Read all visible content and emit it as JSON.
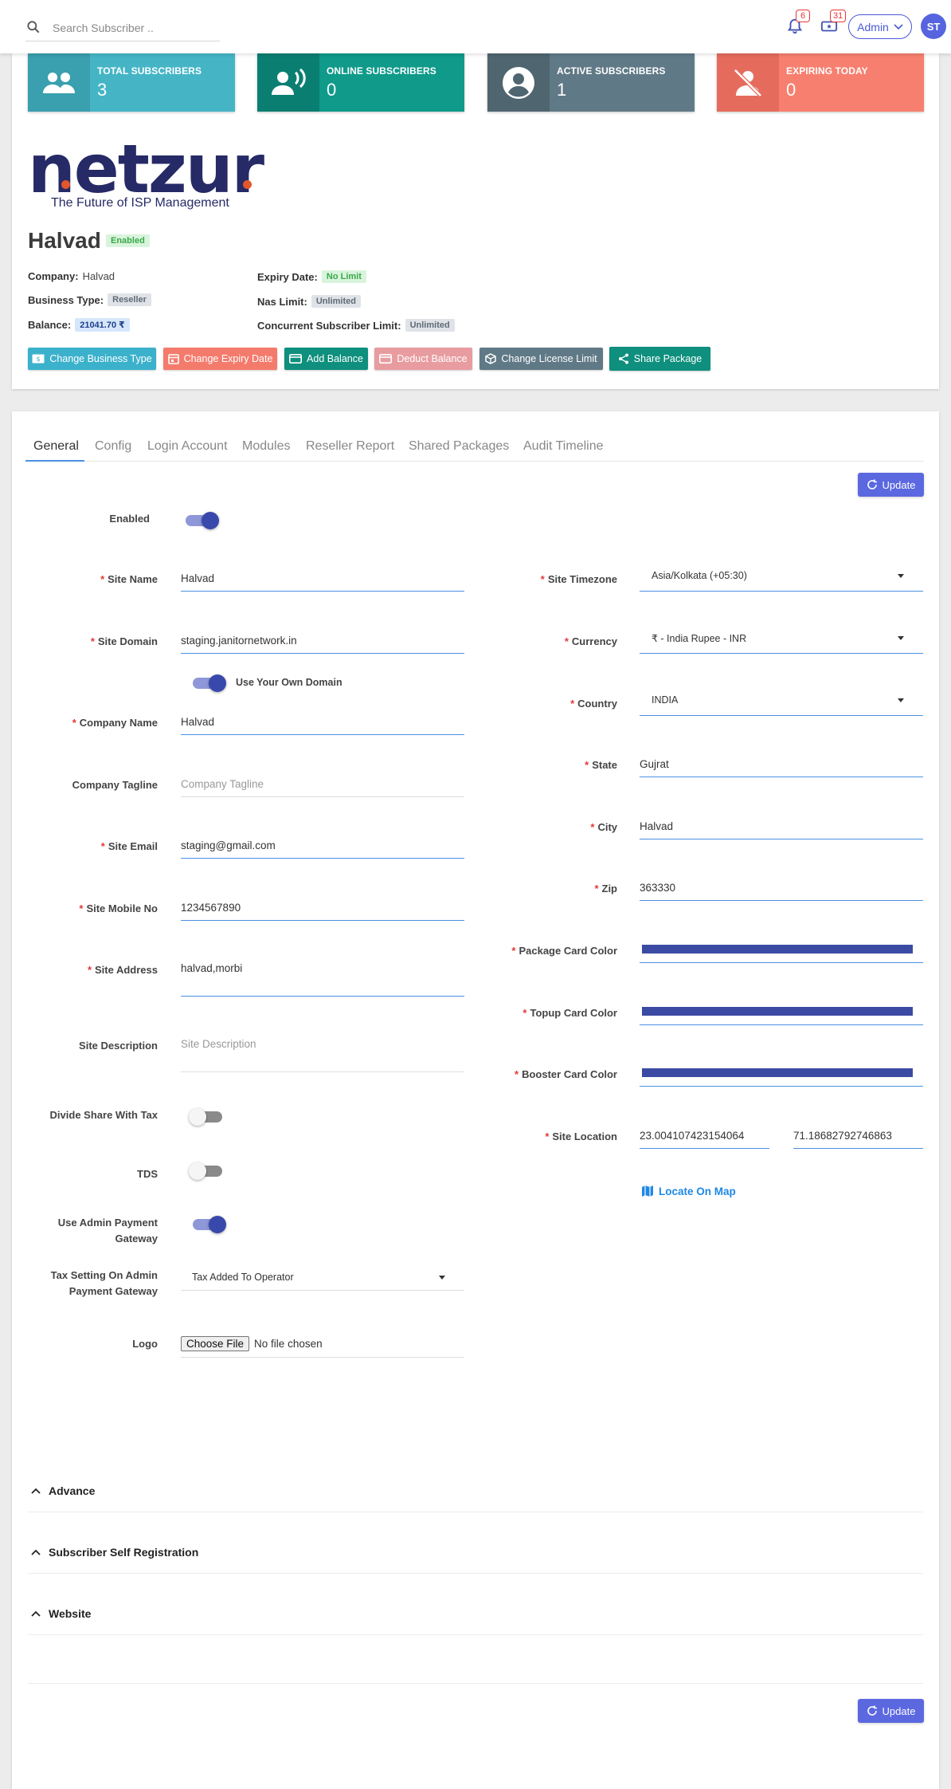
{
  "search": {
    "placeholder": "Search Subscriber .."
  },
  "notifications": {
    "alerts_count": "6",
    "tickets_count": "31"
  },
  "user": {
    "menu_label": "Admin",
    "avatar_initials": "ST"
  },
  "stats": [
    {
      "label": "TOTAL SUBSCRIBERS",
      "value": "3",
      "color": "#45b5c6",
      "icon": "group-icon"
    },
    {
      "label": "ONLINE SUBSCRIBERS",
      "value": "0",
      "color": "#0f9a8a",
      "icon": "voice-user-icon"
    },
    {
      "label": "ACTIVE SUBSCRIBERS",
      "value": "1",
      "color": "#607986",
      "icon": "account-circle-icon"
    },
    {
      "label": "EXPIRING TODAY",
      "value": "0",
      "color": "#f77f6f",
      "icon": "user-off-icon"
    }
  ],
  "brand": {
    "logo_text": "netzur",
    "tagline": "The Future of ISP Management"
  },
  "profile": {
    "name": "Halvad",
    "status": "Enabled",
    "company_label": "Company:",
    "company_value": "Halvad",
    "business_type_label": "Business Type:",
    "business_type_value": "Reseller",
    "balance_label": "Balance:",
    "balance_value": "21041.70 ₹",
    "expiry_label": "Expiry Date:",
    "expiry_value": "No Limit",
    "nas_label": "Nas Limit:",
    "nas_value": "Unlimited",
    "concurrent_label": "Concurrent Subscriber Limit:",
    "concurrent_value": "Unlimited"
  },
  "actions": {
    "change_business_type": "Change Business Type",
    "change_expiry_date": "Change Expiry Date",
    "add_balance": "Add Balance",
    "deduct_balance": "Deduct Balance",
    "change_license_limit": "Change License Limit",
    "share_package": "Share Package"
  },
  "tabs": [
    "General",
    "Config",
    "Login Account",
    "Modules",
    "Reseller Report",
    "Shared Packages",
    "Audit Timeline"
  ],
  "update_label": "Update",
  "form": {
    "enabled_label": "Enabled",
    "site_name_label": "Site Name",
    "site_name_value": "Halvad",
    "site_domain_label": "Site Domain",
    "site_domain_value": "staging.janitornetwork.in",
    "own_domain_label": "Use Your Own Domain",
    "company_name_label": "Company Name",
    "company_name_value": "Halvad",
    "company_tagline_label": "Company Tagline",
    "company_tagline_placeholder": "Company Tagline",
    "site_email_label": "Site Email",
    "site_email_value": "staging@gmail.com",
    "site_mobile_label": "Site Mobile No",
    "site_mobile_value": "1234567890",
    "site_address_label": "Site Address",
    "site_address_value": "halvad,morbi",
    "site_description_label": "Site Description",
    "site_description_placeholder": "Site Description",
    "divide_share_label": "Divide Share With Tax",
    "tds_label": "TDS",
    "admin_gateway_label": "Use Admin Payment Gateway",
    "tax_setting_label": "Tax Setting On Admin Payment Gateway",
    "tax_setting_value": "Tax Added To Operator",
    "logo_label": "Logo",
    "logo_button": "Choose File",
    "logo_status": "No file chosen",
    "timezone_label": "Site Timezone",
    "timezone_value": "Asia/Kolkata (+05:30)",
    "currency_label": "Currency",
    "currency_value": "₹ - India Rupee - INR",
    "country_label": "Country",
    "country_value": "INDIA",
    "state_label": "State",
    "state_value": "Gujrat",
    "city_label": "City",
    "city_value": "Halvad",
    "zip_label": "Zip",
    "zip_value": "363330",
    "package_color_label": "Package Card Color",
    "topup_color_label": "Topup Card Color",
    "booster_color_label": "Booster Card Color",
    "card_color": "#3b4aa2",
    "location_label": "Site Location",
    "latitude": "23.004107423154064",
    "longitude": "71.18682792746863",
    "locate_label": "Locate On Map"
  },
  "sections": [
    "Advance",
    "Subscriber Self Registration",
    "Website"
  ]
}
